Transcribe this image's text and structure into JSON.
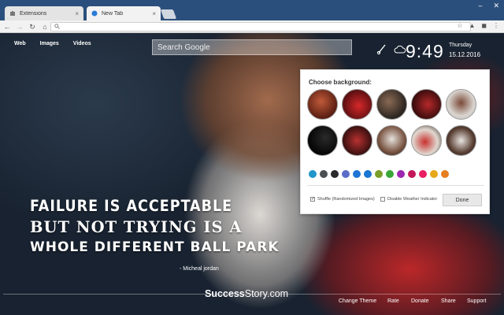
{
  "tabs": [
    {
      "title": "Extensions",
      "close": "×"
    },
    {
      "title": "New Tab",
      "close": "×"
    }
  ],
  "window": {
    "minimize": "–",
    "close": "✕"
  },
  "toolbar": {
    "back": "←",
    "forward": "→",
    "reload": "↻",
    "home": "⌂",
    "omnibox_icon": "🔍"
  },
  "header": {
    "links": [
      "Web",
      "Images",
      "Videos"
    ],
    "search_placeholder": "Search Google"
  },
  "clock": {
    "time": "9:49",
    "day": "Thursday",
    "date": "15.12.2016"
  },
  "panel": {
    "title": "Choose background:",
    "swatch_colors": [
      "#2196c9",
      "#4b4f52",
      "#2a2a2a",
      "#5a6ec8",
      "#1e74d4",
      "#1976d2",
      "#7a9e2a",
      "#3aa637",
      "#9c27b0",
      "#c2185b",
      "#e91e63",
      "#e6a817",
      "#e67e22"
    ],
    "shuffle_label": "Shuffle (Randomized Images)",
    "shuffle_checked": true,
    "weather_label": "Disable Weather Indicator",
    "weather_checked": false,
    "done_label": "Done"
  },
  "quote": {
    "line1": "FAILURE IS ACCEPTABLE",
    "line2": "BUT NOT TRYING IS A",
    "line3": "WHOLE DIFFERENT BALL PARK",
    "author": "- Micheal jordan"
  },
  "brand": {
    "bold": "Success",
    "rest": "Story.com"
  },
  "footer": {
    "links": [
      "Change Theme",
      "Rate",
      "Donate",
      "Share",
      "Support"
    ]
  }
}
